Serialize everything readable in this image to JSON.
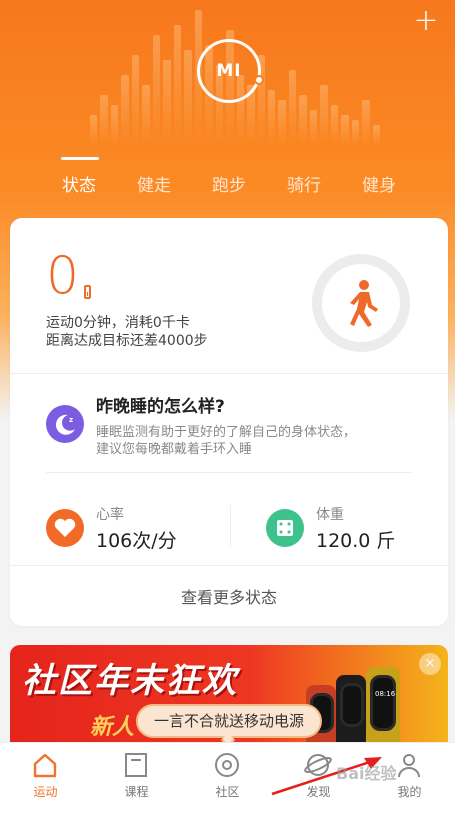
{
  "header": {
    "logo_text": "MI",
    "add_label": "+"
  },
  "tabs": [
    {
      "label": "状态"
    },
    {
      "label": "健走"
    },
    {
      "label": "跑步"
    },
    {
      "label": "骑行"
    },
    {
      "label": "健身"
    }
  ],
  "steps_card": {
    "steps": "0",
    "line1": "运动0分钟，消耗0千卡",
    "line2": "距离达成目标还差4000步"
  },
  "sleep": {
    "title": "昨晚睡的怎么样?",
    "desc_line1": "睡眠监测有助于更好的了解自己的身体状态，",
    "desc_line2": "建议您每晚都戴着手环入睡"
  },
  "heart_rate": {
    "label": "心率",
    "value": "106次/分"
  },
  "weight": {
    "label": "体重",
    "value": "120.0 斤"
  },
  "more_label": "查看更多状态",
  "banner": {
    "title": "社区年末狂欢",
    "sub": "新人",
    "watch_time": "08:16",
    "close_label": "×"
  },
  "tooltip": "一言不合就送移动电源",
  "bottom_nav": [
    {
      "label": "运动",
      "icon": "home-icon"
    },
    {
      "label": "课程",
      "icon": "course-icon"
    },
    {
      "label": "社区",
      "icon": "community-icon"
    },
    {
      "label": "发现",
      "icon": "discover-icon"
    },
    {
      "label": "我的",
      "icon": "profile-icon"
    }
  ],
  "watermark": "Bai经验",
  "colors": {
    "accent": "#f2742a",
    "sleep": "#7c5ce0",
    "heart": "#f26a27",
    "weight": "#3cc28a"
  }
}
